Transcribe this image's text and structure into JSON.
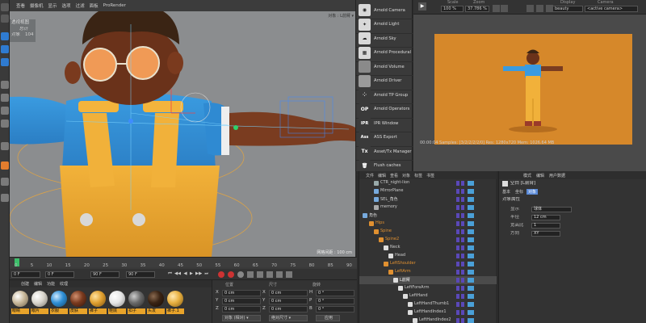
{
  "viewport": {
    "menu": [
      "查看",
      "摄像机",
      "显示",
      "选项",
      "过滤",
      "面板",
      "ProRender"
    ],
    "panel": [
      "透视视图",
      "总计",
      "对象",
      "104"
    ],
    "status": "网格间距 : 100 cm",
    "object_label": "对象 : L前臂 ▾"
  },
  "palette": {
    "items": [
      {
        "label": "Arnold Camera",
        "icon": "camera-icon"
      },
      {
        "label": "Arnold Light",
        "icon": "light-icon"
      },
      {
        "label": "Arnold Sky",
        "icon": "sky-icon"
      },
      {
        "label": "Arnold Procedural",
        "icon": "procedural-icon"
      },
      {
        "label": "Arnold Volume",
        "icon": "volume-icon"
      },
      {
        "label": "Arnold Driver",
        "icon": "driver-icon"
      },
      {
        "label": "Arnold TP Group",
        "icon": "tp-group-icon"
      },
      {
        "label": "Arnold Operators",
        "icon": "operators-icon",
        "glyph": "OP"
      },
      {
        "label": "IPR Window",
        "icon": "ipr-icon",
        "glyph": "IPR"
      },
      {
        "label": "ASS Export",
        "icon": "ass-icon",
        "glyph": "Ass"
      },
      {
        "label": "Asset/Tx Manager",
        "icon": "tx-icon",
        "glyph": "Tx"
      },
      {
        "label": "Flush caches",
        "icon": "trash-icon"
      }
    ]
  },
  "renderview": {
    "scale_label": "Scale",
    "scale_value": "100 %",
    "zoom_label": "Zoom",
    "zoom_value": "37.786 %",
    "display_label": "Display",
    "display_value": "beauty",
    "camera_label": "Camera",
    "camera_value": "<active camera>",
    "status": "00:00:04  Samples: [3/2/2/2/2/0]  Res: 1280x720  Mem: 1026.64 MB",
    "accent": "#d6882a"
  },
  "objmgr": {
    "menu": [
      "文件",
      "编辑",
      "查看",
      "对象",
      "标签",
      "书签"
    ],
    "rows": [
      {
        "name": "CTR_night-lion",
        "indent": 24,
        "color": "#9aa"
      },
      {
        "name": "MirrorPlane",
        "indent": 24,
        "color": "#7ad"
      },
      {
        "name": "SEL_角色",
        "indent": 24,
        "color": "#7ad"
      },
      {
        "name": "memory",
        "indent": 24,
        "color": "#aaa"
      },
      {
        "name": "角色",
        "indent": 4,
        "color": "#7ad"
      },
      {
        "name": "Hips",
        "indent": 12,
        "color": "#e09030"
      },
      {
        "name": "Spine",
        "indent": 18,
        "color": "#e09030"
      },
      {
        "name": "Spine2",
        "indent": 24,
        "color": "#e09030"
      },
      {
        "name": "Neck",
        "indent": 30,
        "color": "#ddd"
      },
      {
        "name": "Head",
        "indent": 36,
        "color": "#ddd"
      },
      {
        "name": "LeftShoulder",
        "indent": 30,
        "color": "#e09030"
      },
      {
        "name": "LeftArm",
        "indent": 36,
        "color": "#e09030"
      },
      {
        "name": "L前臂",
        "indent": 42,
        "color": "#ddd",
        "selected": true
      },
      {
        "name": "LeftForeArm",
        "indent": 48,
        "color": "#ddd"
      },
      {
        "name": "LeftHand",
        "indent": 54,
        "color": "#ddd"
      },
      {
        "name": "LeftHandThumb1",
        "indent": 60,
        "color": "#ddd"
      },
      {
        "name": "LeftHandIndex1",
        "indent": 60,
        "color": "#ddd"
      },
      {
        "name": "LeftHandIndex2",
        "indent": 66,
        "color": "#ddd"
      }
    ]
  },
  "attrmgr": {
    "menu": [
      "模式",
      "编辑",
      "用户数据"
    ],
    "title": "空白 [L前臂]",
    "tabs": [
      "基本",
      "坐标",
      "对象"
    ],
    "section": "对象属性",
    "fields": [
      {
        "label": "显示",
        "value": "球体"
      },
      {
        "label": "半径",
        "value": "12 cm"
      },
      {
        "label": "宽高比",
        "value": "1"
      },
      {
        "label": "方向",
        "value": "XY"
      }
    ]
  },
  "timeline": {
    "ticks": [
      "0",
      "5",
      "10",
      "15",
      "20",
      "25",
      "30",
      "35",
      "40",
      "45",
      "50",
      "55",
      "60",
      "65",
      "70",
      "75",
      "80",
      "85",
      "90"
    ],
    "start": "0 F",
    "start2": "0 F",
    "end": "90 F",
    "end2": "90 F"
  },
  "matmgr": {
    "menu": [
      "创建",
      "编辑",
      "功能",
      "纹理"
    ],
    "materials": [
      {
        "label": "眼睛",
        "color": "#c8b89a"
      },
      {
        "label": "眼片",
        "color": "#d9d5cc"
      },
      {
        "label": "衣服",
        "color": "#2f8fd6"
      },
      {
        "label": "皮肤",
        "color": "#7a3a1e"
      },
      {
        "label": "裤子",
        "color": "#e0a030"
      },
      {
        "label": "鞋底",
        "color": "#e6e6e6"
      },
      {
        "label": "扣子",
        "color": "#6a6a6a"
      },
      {
        "label": "头发",
        "color": "#3a2414"
      },
      {
        "label": "裤子.1",
        "color": "#e8b040"
      }
    ]
  },
  "coordmgr": {
    "headers": [
      "位置",
      "尺寸",
      "旋转"
    ],
    "rows": [
      {
        "axis": "X",
        "pos": "0 cm",
        "size": "0 cm",
        "rlabel": "H",
        "rot": "0 °"
      },
      {
        "axis": "Y",
        "pos": "0 cm",
        "size": "0 cm",
        "rlabel": "P",
        "rot": "0 °"
      },
      {
        "axis": "Z",
        "pos": "0 cm",
        "size": "0 cm",
        "rlabel": "B",
        "rot": "0 °"
      }
    ],
    "mode": "对象 (相对) ▾",
    "size_mode": "绝对尺寸 ▾",
    "apply": "应用"
  }
}
